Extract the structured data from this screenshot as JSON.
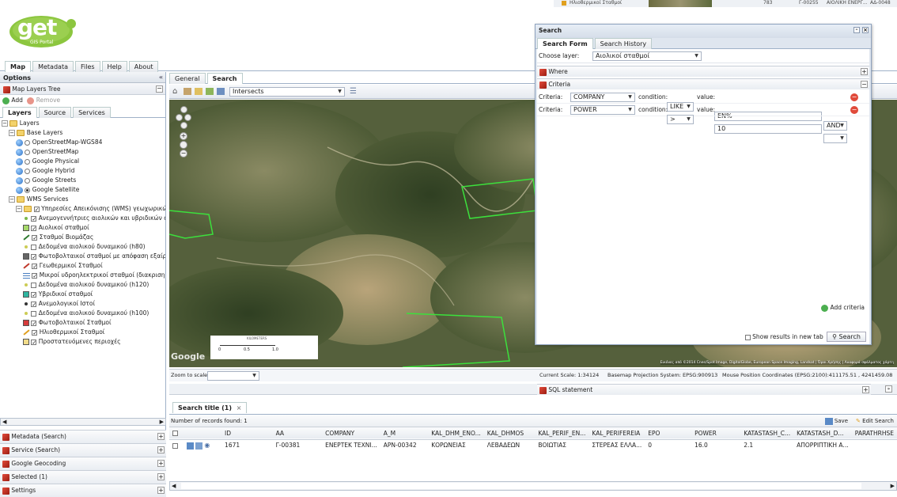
{
  "app": {
    "logo_text": "get",
    "logo_sub": "GIS Portal"
  },
  "top_tabs": [
    "Map",
    "Metadata",
    "Files",
    "Help",
    "About"
  ],
  "options": {
    "title": "Options",
    "map_layers_tree": "Map Layers Tree",
    "add_label": "Add",
    "remove_label": "Remove",
    "subtabs": [
      "Layers",
      "Source",
      "Services"
    ],
    "tree": [
      {
        "indent": 0,
        "icon": "folder",
        "ctrl": "none",
        "label": "Layers"
      },
      {
        "indent": 1,
        "icon": "folder",
        "ctrl": "none",
        "label": "Base Layers"
      },
      {
        "indent": 2,
        "icon": "globe",
        "ctrl": "radio",
        "checked": false,
        "label": "OpenStreetMap-WGS84"
      },
      {
        "indent": 2,
        "icon": "globe",
        "ctrl": "radio",
        "checked": false,
        "label": "OpenStreetMap"
      },
      {
        "indent": 2,
        "icon": "globe",
        "ctrl": "radio",
        "checked": false,
        "label": "Google Physical"
      },
      {
        "indent": 2,
        "icon": "globe",
        "ctrl": "radio",
        "checked": false,
        "label": "Google Hybrid"
      },
      {
        "indent": 2,
        "icon": "globe",
        "ctrl": "radio",
        "checked": false,
        "label": "Google Streets"
      },
      {
        "indent": 2,
        "icon": "globe",
        "ctrl": "radio",
        "checked": true,
        "label": "Google Satellite"
      },
      {
        "indent": 1,
        "icon": "folder",
        "ctrl": "none",
        "label": "WMS Services"
      },
      {
        "indent": 2,
        "icon": "folder",
        "ctrl": "check",
        "checked": true,
        "label": "Υπηρεσίες Απεικόνισης (WMS) γεωχωρικών"
      },
      {
        "indent": 3,
        "icon": "dot",
        "color": "#7ab84a",
        "ctrl": "check",
        "checked": true,
        "label": "Ανεμογεννήτριες αιολικών και υβριδικών σ"
      },
      {
        "indent": 3,
        "icon": "square",
        "color": "#a6d96a",
        "ctrl": "check",
        "checked": true,
        "label": "Αιολικοί σταθμοί"
      },
      {
        "indent": 3,
        "icon": "line",
        "color": "#2f7a2f",
        "ctrl": "check",
        "checked": true,
        "label": "Σταθμοί Βιομάζας"
      },
      {
        "indent": 3,
        "icon": "dot",
        "color": "#cccc55",
        "ctrl": "check",
        "checked": false,
        "label": "Δεδομένα αιολικού δυναμικού (h80)"
      },
      {
        "indent": 3,
        "icon": "square",
        "color": "#666666",
        "ctrl": "check",
        "checked": true,
        "label": "Φωτοβολταικοί σταθμοί με απόφαση εξαίρε"
      },
      {
        "indent": 3,
        "icon": "line",
        "color": "#c0392b",
        "ctrl": "check",
        "checked": true,
        "label": "Γεωθερμικοί Σταθμοί"
      },
      {
        "indent": 3,
        "icon": "hatch",
        "color": "#4a7fc1",
        "ctrl": "check",
        "checked": true,
        "label": "Μικροί υδροηλεκτρικοί σταθμοί (διακριση Υ"
      },
      {
        "indent": 3,
        "icon": "dot",
        "color": "#cccc55",
        "ctrl": "check",
        "checked": false,
        "label": "Δεδομένα αιολικού δυναμικού (h120)"
      },
      {
        "indent": 3,
        "icon": "square",
        "color": "#2fb5a0",
        "ctrl": "check",
        "checked": true,
        "label": "Υβριδικοί σταθμοί"
      },
      {
        "indent": 3,
        "icon": "dot",
        "color": "#333333",
        "ctrl": "check",
        "checked": true,
        "label": "Ανεμολογικοί Ιστοί"
      },
      {
        "indent": 3,
        "icon": "dot",
        "color": "#cccc55",
        "ctrl": "check",
        "checked": false,
        "label": "Δεδομένα αιολικού δυναμικού (h100)"
      },
      {
        "indent": 3,
        "icon": "square",
        "color": "#d63b3b",
        "ctrl": "check",
        "checked": true,
        "label": "Φωτοβολταικοί Σταθμοί"
      },
      {
        "indent": 3,
        "icon": "line",
        "color": "#e0a020",
        "ctrl": "check",
        "checked": true,
        "label": "Ηλιοθερμικοί Σταθμοί"
      },
      {
        "indent": 3,
        "icon": "square",
        "color": "#f2dc8a",
        "ctrl": "check",
        "checked": true,
        "label": "Προστατευόμενες περιοχές"
      }
    ],
    "bottom_panels": [
      "Metadata (Search)",
      "Service (Search)",
      "Google Geocoding",
      "Selected (1)",
      "Settings"
    ]
  },
  "map_tabs": [
    "General",
    "Search"
  ],
  "toolbar": {
    "spatial_op": "Intersects"
  },
  "map": {
    "google_label": "Google",
    "scale_label": "KILOMETERS",
    "scale_ticks": [
      "0",
      "0.5",
      "1.0"
    ],
    "attribution": "Εικόνες από ©2014 Cnes/Spot Image, DigitalGlobe, European Space Imaging, Landsat | Όροι Χρήσης | Αναφορά σφάλματος χάρτη"
  },
  "statusbar": {
    "zoom_label": "Zoom to scale:",
    "current_scale": "Current Scale: 1:34124",
    "basemap_proj": "Basemap Projection System: EPSG:900913",
    "mouse_pos": "Mouse Position Coordinates (EPSG:2100):411175.51 , 4241459.08"
  },
  "results": {
    "tab_title": "Search title (1)",
    "records_found": "Number of records found: 1",
    "save_label": "Save",
    "edit_label": "Edit Search",
    "columns": [
      "ID",
      "AA",
      "COMPANY",
      "A_M",
      "KAL_DHM_ENO...",
      "KAL_DHMOS",
      "KAL_PERIF_EN...",
      "KAL_PERIFEREIA",
      "EPO",
      "POWER",
      "KATASTASH_C...",
      "KATASTASH_D...",
      "PARATHRHSE"
    ],
    "rows": [
      [
        "1671",
        "Γ-00381",
        "ΕΝΕΡΤΕΚ ΤΕΧΝΙ...",
        "ΑΡΝ-00342",
        "ΚΟΡΩΝΕΙΑΣ",
        "ΛΕΒΑΔΕΩΝ",
        "ΒΟΙΩΤΙΑΣ",
        "ΣΤΕΡΕΑΣ ΕΛΛΑ...",
        "0",
        "16.0",
        "2.1",
        "ΑΠΟΡΡΙΠΤΙΚΗ Α...",
        ""
      ]
    ]
  },
  "search_window": {
    "title": "Search",
    "tabs": [
      "Search Form",
      "Search History"
    ],
    "choose_layer_label": "Choose layer:",
    "choose_layer_value": "Αιολικοί σταθμοί",
    "where_label": "Where",
    "criteria_label": "Criteria",
    "criteria": [
      {
        "label": "Criteria:",
        "field": "COMPANY",
        "cond_label": "condition:",
        "cond": "LIKE",
        "val_label": "value:",
        "value": "EN%",
        "logic": "AND"
      },
      {
        "label": "Criteria:",
        "field": "POWER",
        "cond_label": "condition:",
        "cond": ">",
        "val_label": "value:",
        "value": "10",
        "logic": ""
      }
    ],
    "add_criteria_label": "Add criteria",
    "sql_label": "SQL statement",
    "show_new_tab_label": "Show results in new tab",
    "search_button_label": "Search"
  },
  "top_strip": {
    "item1": "Ηλιοθερμικοί Σταθμοί",
    "n1": "783",
    "n2": "Γ-00255",
    "n3": "ΑΙΟΛΙΚΗ ΕΝΕΡΓ...",
    "n4": "ΑΔ-0048"
  }
}
